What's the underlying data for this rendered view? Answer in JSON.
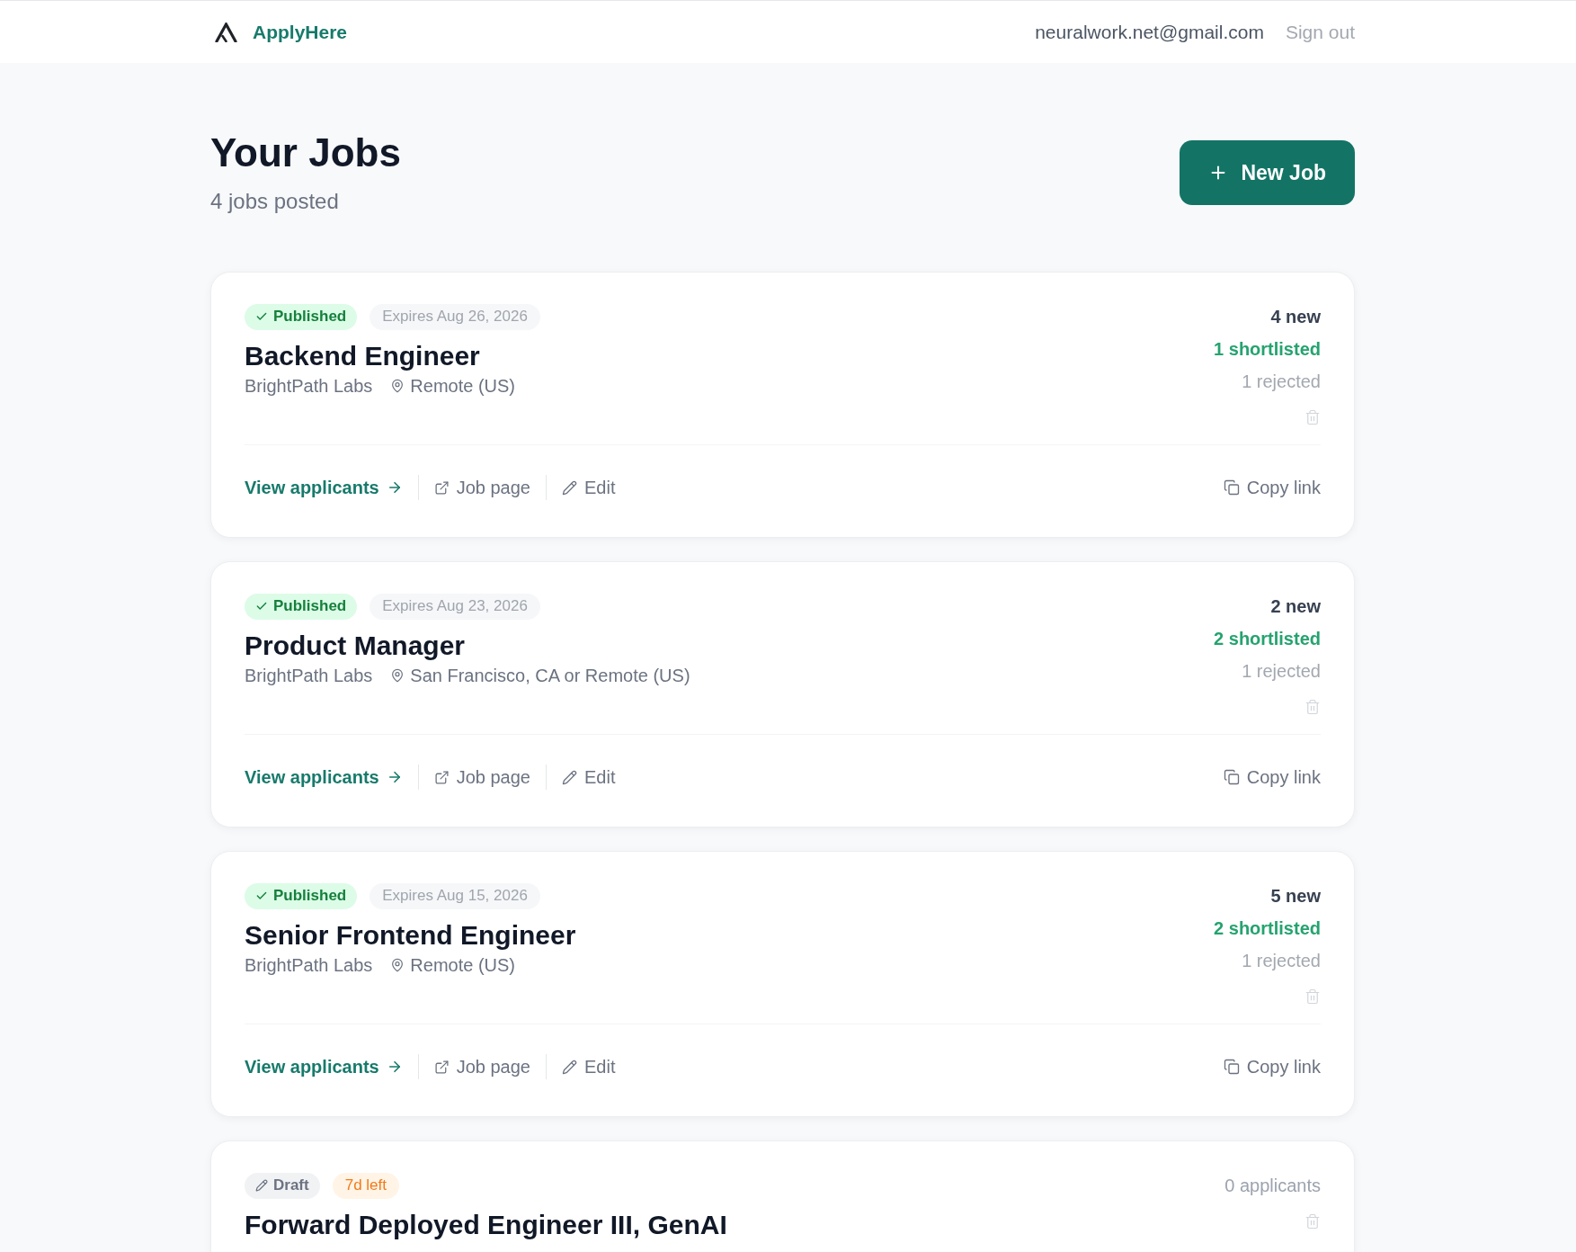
{
  "header": {
    "brand": "ApplyHere",
    "email": "neuralwork.net@gmail.com",
    "sign_out": "Sign out"
  },
  "page": {
    "title": "Your Jobs",
    "subtitle": "4 jobs posted",
    "new_job_button": "New Job"
  },
  "jobs": [
    {
      "status": {
        "kind": "published",
        "label": "Published"
      },
      "timing": {
        "kind": "expires",
        "text": "Expires Aug 26, 2026"
      },
      "title": "Backend Engineer",
      "company": "BrightPath Labs",
      "location": "Remote (US)",
      "stats": [
        {
          "kind": "new",
          "text": "4 new"
        },
        {
          "kind": "shortlisted",
          "text": "1 shortlisted"
        },
        {
          "kind": "rejected",
          "text": "1 rejected"
        }
      ],
      "actions": [
        {
          "kind": "view_applicants",
          "label": "View applicants"
        },
        {
          "kind": "job_page",
          "label": "Job page"
        },
        {
          "kind": "edit",
          "label": "Edit"
        },
        {
          "kind": "copy_link",
          "label": "Copy link"
        }
      ]
    },
    {
      "status": {
        "kind": "published",
        "label": "Published"
      },
      "timing": {
        "kind": "expires",
        "text": "Expires Aug 23, 2026"
      },
      "title": "Product Manager",
      "company": "BrightPath Labs",
      "location": "San Francisco, CA or Remote (US)",
      "stats": [
        {
          "kind": "new",
          "text": "2 new"
        },
        {
          "kind": "shortlisted",
          "text": "2 shortlisted"
        },
        {
          "kind": "rejected",
          "text": "1 rejected"
        }
      ],
      "actions": [
        {
          "kind": "view_applicants",
          "label": "View applicants"
        },
        {
          "kind": "job_page",
          "label": "Job page"
        },
        {
          "kind": "edit",
          "label": "Edit"
        },
        {
          "kind": "copy_link",
          "label": "Copy link"
        }
      ]
    },
    {
      "status": {
        "kind": "published",
        "label": "Published"
      },
      "timing": {
        "kind": "expires",
        "text": "Expires Aug 15, 2026"
      },
      "title": "Senior Frontend Engineer",
      "company": "BrightPath Labs",
      "location": "Remote (US)",
      "stats": [
        {
          "kind": "new",
          "text": "5 new"
        },
        {
          "kind": "shortlisted",
          "text": "2 shortlisted"
        },
        {
          "kind": "rejected",
          "text": "1 rejected"
        }
      ],
      "actions": [
        {
          "kind": "view_applicants",
          "label": "View applicants"
        },
        {
          "kind": "job_page",
          "label": "Job page"
        },
        {
          "kind": "edit",
          "label": "Edit"
        },
        {
          "kind": "copy_link",
          "label": "Copy link"
        }
      ]
    },
    {
      "status": {
        "kind": "draft",
        "label": "Draft"
      },
      "timing": {
        "kind": "deadline",
        "text": "7d left"
      },
      "title": "Forward Deployed Engineer III, GenAI",
      "stats": [
        {
          "kind": "applicants",
          "text": "0 applicants"
        }
      ]
    }
  ]
}
